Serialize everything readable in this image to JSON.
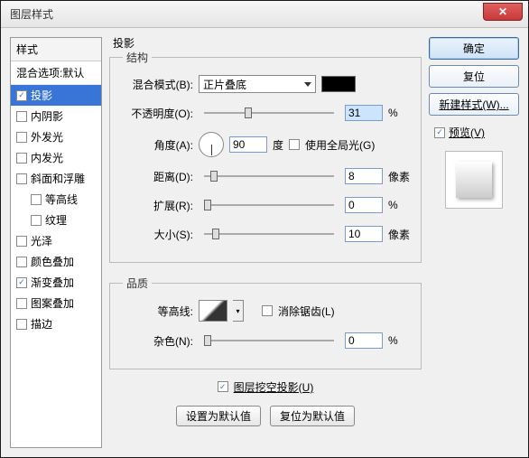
{
  "window": {
    "title": "图层样式",
    "close": "✕"
  },
  "sidebar": {
    "header": "样式",
    "blend": "混合选项:默认",
    "items": [
      {
        "label": "投影",
        "checked": true,
        "selected": true
      },
      {
        "label": "内阴影",
        "checked": false
      },
      {
        "label": "外发光",
        "checked": false
      },
      {
        "label": "内发光",
        "checked": false
      },
      {
        "label": "斜面和浮雕",
        "checked": false
      },
      {
        "label": "等高线",
        "checked": false,
        "indent": true
      },
      {
        "label": "纹理",
        "checked": false,
        "indent": true
      },
      {
        "label": "光泽",
        "checked": false
      },
      {
        "label": "颜色叠加",
        "checked": false
      },
      {
        "label": "渐变叠加",
        "checked": true
      },
      {
        "label": "图案叠加",
        "checked": false
      },
      {
        "label": "描边",
        "checked": false
      }
    ]
  },
  "main": {
    "title": "投影",
    "structure": {
      "legend": "结构",
      "blend_mode_label": "混合模式(B):",
      "blend_mode_value": "正片叠底",
      "opacity_label": "不透明度(O):",
      "opacity_value": "31",
      "opacity_unit": "%",
      "angle_label": "角度(A):",
      "angle_value": "90",
      "angle_unit": "度",
      "global_light_label": "使用全局光(G)",
      "global_light_checked": false,
      "distance_label": "距离(D):",
      "distance_value": "8",
      "distance_unit": "像素",
      "spread_label": "扩展(R):",
      "spread_value": "0",
      "spread_unit": "%",
      "size_label": "大小(S):",
      "size_value": "10",
      "size_unit": "像素"
    },
    "quality": {
      "legend": "品质",
      "contour_label": "等高线:",
      "antialias_label": "消除锯齿(L)",
      "antialias_checked": false,
      "noise_label": "杂色(N):",
      "noise_value": "0",
      "noise_unit": "%"
    },
    "knockout_label": "图层挖空投影(U)",
    "knockout_checked": true,
    "btn_default": "设置为默认值",
    "btn_reset": "复位为默认值"
  },
  "right": {
    "ok": "确定",
    "cancel": "复位",
    "new_style": "新建样式(W)...",
    "preview_label": "预览(V)",
    "preview_checked": true
  }
}
